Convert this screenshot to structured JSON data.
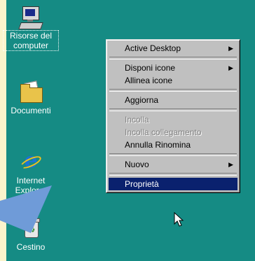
{
  "desktop": {
    "icons": [
      {
        "label": "Risorse del computer",
        "icon": "my-computer-icon"
      },
      {
        "label": "Documenti",
        "icon": "documents-folder-icon"
      },
      {
        "label": "Internet Explorer",
        "icon": "internet-explorer-icon"
      },
      {
        "label": "Cestino",
        "icon": "recycle-bin-icon"
      }
    ]
  },
  "context_menu": {
    "active_desktop": "Active Desktop",
    "disponi_icone": "Disponi icone",
    "allinea_icone": "Allinea icone",
    "aggiorna": "Aggiorna",
    "incolla": "Incolla",
    "incolla_collegamento": "Incolla collegamento",
    "annulla_rinomina": "Annulla Rinomina",
    "nuovo": "Nuovo",
    "proprieta": "Proprietà",
    "submenu_arrow": "▶"
  },
  "colors": {
    "desktop_bg": "#158b84",
    "frame_bg": "#fbf4cc",
    "menu_bg": "#c0c0c0",
    "highlight": "#0a216e",
    "pointer_callout": "#6f9bd8"
  }
}
